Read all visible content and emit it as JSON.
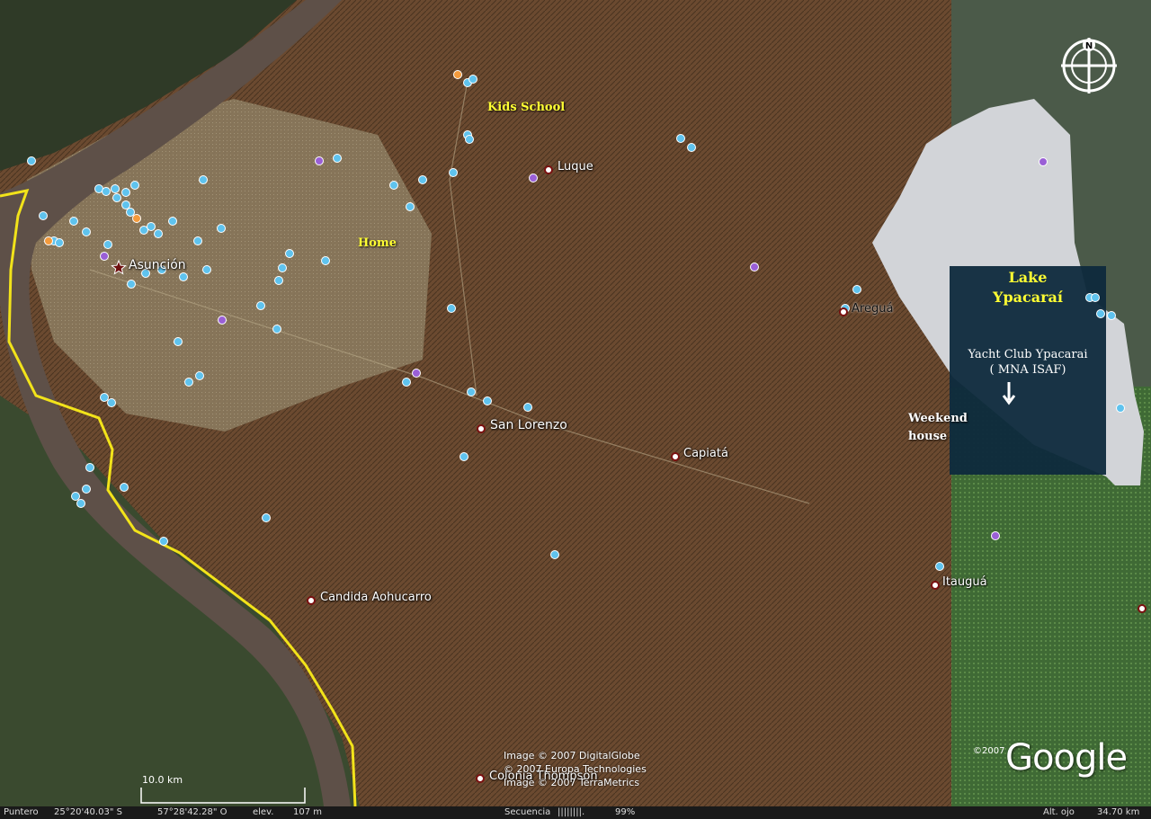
{
  "colors": {
    "city_terrain": "#6b4a30",
    "river": "#5e5048",
    "border_line": "#f2e31a",
    "lake_water": "#d2d4d8",
    "info_box": "#0e2a3d",
    "marker_blue": "#5fc3ee",
    "marker_purple": "#9a5fd6",
    "marker_orange": "#f39a3c",
    "label_yellow": "#ffff33"
  },
  "cities": [
    {
      "name": "Asunción",
      "marker": "star-icon"
    },
    {
      "name": "Luque",
      "marker": "circle-marker-icon"
    },
    {
      "name": "Areguá",
      "marker": "circle-marker-icon"
    },
    {
      "name": "San Lorenzo",
      "marker": "circle-marker-icon"
    },
    {
      "name": "Capiatá",
      "marker": "circle-marker-icon"
    },
    {
      "name": "Candida Aohucarro",
      "marker": "circle-marker-icon"
    },
    {
      "name": "Itauguá",
      "marker": "circle-marker-icon"
    },
    {
      "name": "Colonia Thompson",
      "marker": "circle-marker-icon"
    }
  ],
  "annotations": {
    "kids_school": "Kids School",
    "home": "Home",
    "lake_line1": "Lake",
    "lake_line2": "Ypacaraí",
    "yacht_line1": "Yacht Club Ypacarai",
    "yacht_line2": "( MNA ISAF)",
    "weekend_line1": "Weekend",
    "weekend_line2": "house"
  },
  "copyright": {
    "line1": "Image © 2007 DigitalGlobe",
    "line2": "© 2007 Europa Technologies",
    "line3": "Image © 2007 TerraMetrics",
    "year_small": "©2007",
    "logo": "Google"
  },
  "scale": {
    "label": "10.0 km"
  },
  "compass": {
    "north_label": "N"
  },
  "status": {
    "pointer_label": "Puntero",
    "lat": "25°20'40.03\" S",
    "lon": "57°28'42.28\" O",
    "elev_label": "elev.",
    "elev_value": "107 m",
    "sequence_label": "Secuencia",
    "sequence_bar": "||||||||.",
    "sequence_pct": "99%",
    "eye_label": "Alt. ojo",
    "eye_value": "34.70 km"
  }
}
